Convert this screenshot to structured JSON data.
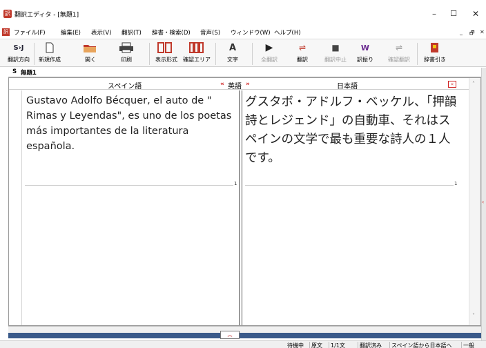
{
  "window": {
    "title": "翻訳エディタ - [無題1]",
    "min": "–",
    "max": "☐",
    "close": "✕"
  },
  "menu": {
    "items": [
      "ファイル(F)",
      "編集(E)",
      "表示(V)",
      "翻訳(T)",
      "辞書・検索(D)",
      "音声(S)",
      "ウィンドウ(W)",
      "ヘルプ(H)"
    ],
    "mdi": [
      "_",
      "🗗",
      "✕"
    ]
  },
  "toolbar": {
    "direction": "翻訳方向",
    "new": "新規作成",
    "open": "開く",
    "print": "印刷",
    "display": "表示形式",
    "confirm_area": "確認エリア",
    "text": "文字",
    "translate_all": "全翻訳",
    "translate": "翻訳",
    "stop": "翻訳中止",
    "furigana": "訳振り",
    "confirm_translate": "確認翻訳",
    "dict_lookup": "辞書引き",
    "direction_icon": "S›J"
  },
  "doc": {
    "tab_prefix": "S",
    "tab_name": "無題1"
  },
  "editor": {
    "source_header": "スペイン語",
    "mid_header": "英語",
    "target_header": "日本語",
    "left_arrows": "«",
    "right_arrows": "»",
    "close_arrows": "«",
    "source_text": "Gustavo Adolfo Bécquer, el auto de \" Rimas y Leyendas\", es uno de los poetas más importantes de la literatura española.",
    "target_text": "グスタボ・アドルフ・ベッケル、「押韻詩とレジェンド」の自動車、それはスペインの文学で最も重要な詩人の１人です。",
    "source_seg": "1",
    "target_seg": "1"
  },
  "status": {
    "state": "待機中",
    "mode": "原文",
    "count": "1/1文",
    "done": "翻訳済み",
    "direction": "スペイン語から日本語へ",
    "field": "一般"
  },
  "icons": {
    "new": "page-icon",
    "open": "folder-icon",
    "print": "printer-icon",
    "translate": "play-icon",
    "stop": "stop-icon"
  }
}
